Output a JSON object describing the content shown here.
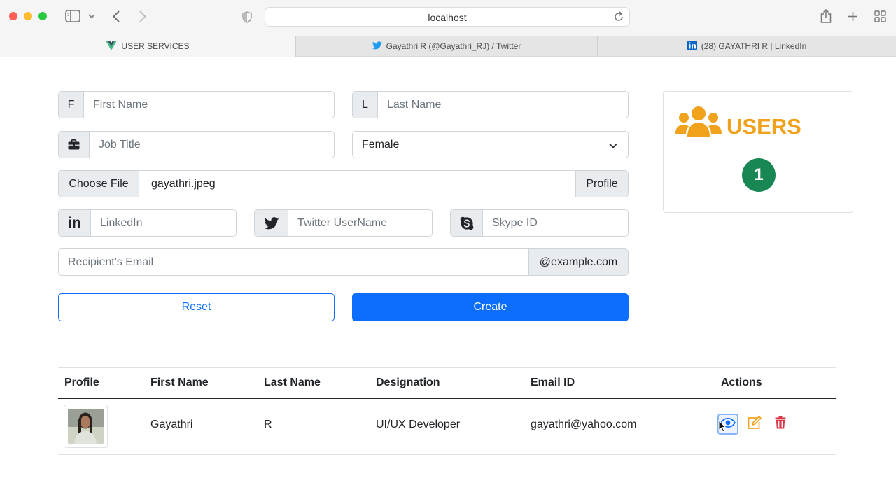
{
  "browser": {
    "url": "localhost",
    "tabs": [
      {
        "label": "USER SERVICES",
        "active": true
      },
      {
        "label": "Gayathri R (@Gayathri_RJ) / Twitter",
        "active": false
      },
      {
        "label": "(28) GAYATHRI R | LinkedIn",
        "active": false
      }
    ]
  },
  "form": {
    "first_name": {
      "addon": "F",
      "placeholder": "First Name"
    },
    "last_name": {
      "addon": "L",
      "placeholder": "Last Name"
    },
    "job_title": {
      "placeholder": "Job Title"
    },
    "gender": {
      "selected": "Female"
    },
    "file": {
      "button": "Choose File",
      "filename": "gayathri.jpeg",
      "addon": "Profile"
    },
    "linkedin": {
      "addon": "in",
      "placeholder": "LinkedIn"
    },
    "twitter": {
      "placeholder": "Twitter UserName"
    },
    "skype": {
      "placeholder": "Skype ID"
    },
    "email": {
      "placeholder": "Recipient's Email",
      "addon": "@example.com"
    },
    "reset_label": "Reset",
    "create_label": "Create"
  },
  "users_card": {
    "title": "USERS",
    "count": "1"
  },
  "table": {
    "headers": [
      "Profile",
      "First Name",
      "Last Name",
      "Designation",
      "Email ID",
      "Actions"
    ],
    "rows": [
      {
        "first_name": "Gayathri",
        "last_name": "R",
        "designation": "UI/UX Developer",
        "email": "gayathri@yahoo.com"
      }
    ]
  },
  "colors": {
    "primary": "#0d6efd",
    "accent": "#f0a21c",
    "success": "#198754",
    "danger": "#dc3545"
  }
}
